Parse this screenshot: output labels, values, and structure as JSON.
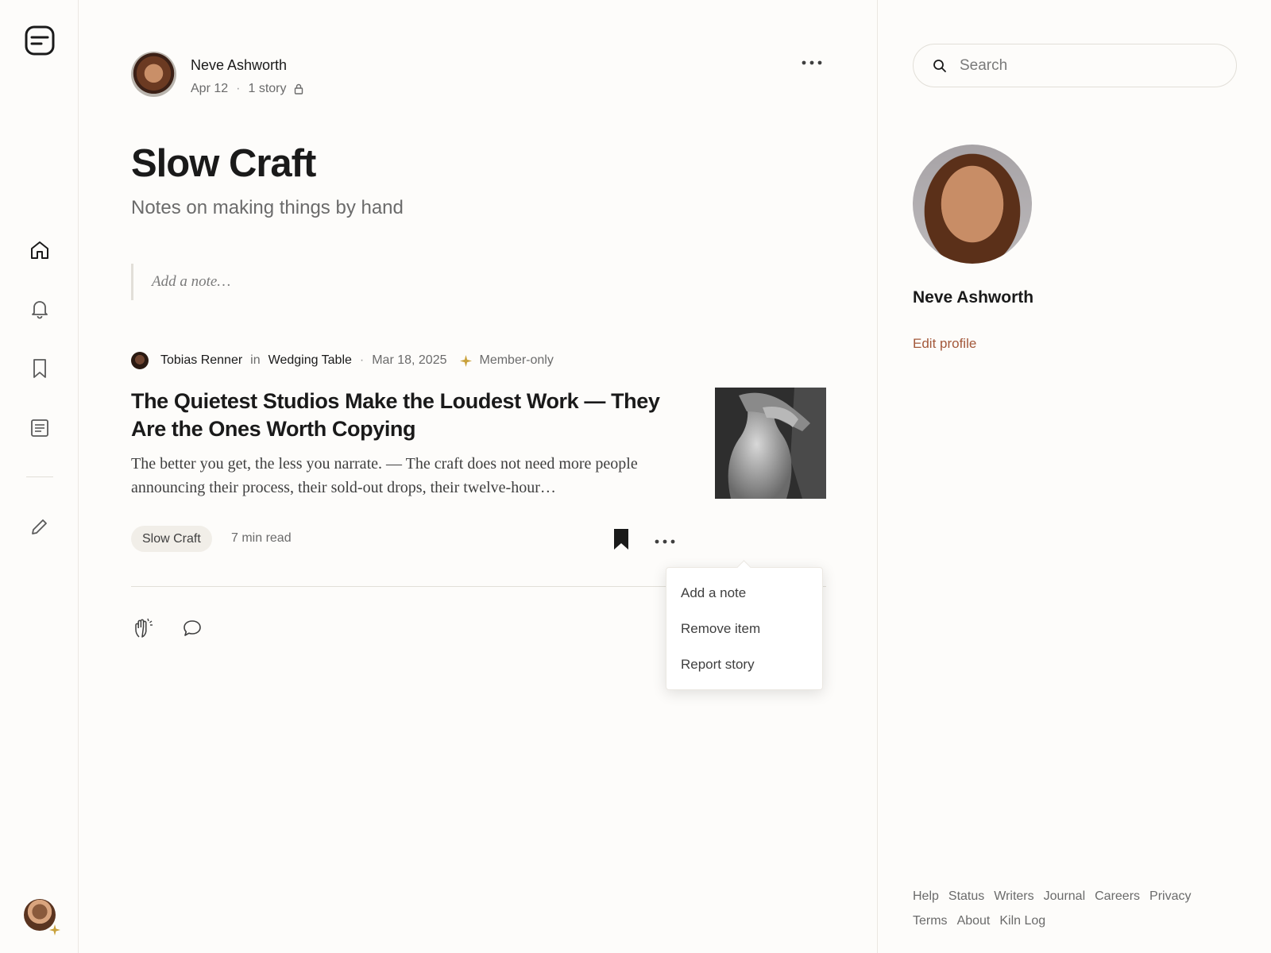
{
  "rail": {
    "icons": [
      "logo-icon",
      "home-icon",
      "bell-icon",
      "bookmark-icon",
      "stories-icon",
      "pencil-icon"
    ]
  },
  "list": {
    "author_name": "Neve Ashworth",
    "date": "Apr 12",
    "story_count": "1 story",
    "title": "Slow Craft",
    "subtitle": "Notes on making things by hand",
    "note_placeholder": "Add a note…"
  },
  "story": {
    "author": "Tobias Renner",
    "in_label": "in",
    "publication": "Wedging Table",
    "date": "Mar 18, 2025",
    "member_label": "Member-only",
    "title": "The Quietest Studios Make the Loudest Work — They Are the Ones Worth Copying",
    "excerpt": "The better you get, the less you narrate. — The craft does not need more people announcing their process, their sold-out drops, their twelve-hour…",
    "tag": "Slow Craft",
    "read_time": "7 min read"
  },
  "menu": {
    "items": [
      "Add a note",
      "Remove item",
      "Report story"
    ]
  },
  "sidebar": {
    "search_placeholder": "Search",
    "profile_name": "Neve Ashworth",
    "edit_profile": "Edit profile"
  },
  "footer": {
    "links": [
      "Help",
      "Status",
      "Writers",
      "Journal",
      "Careers",
      "Privacy",
      "Terms",
      "About",
      "Kiln Log"
    ]
  },
  "colors": {
    "accent_link": "#a3583a",
    "member_star": "#c9a13b",
    "background": "#fdfcfa"
  }
}
